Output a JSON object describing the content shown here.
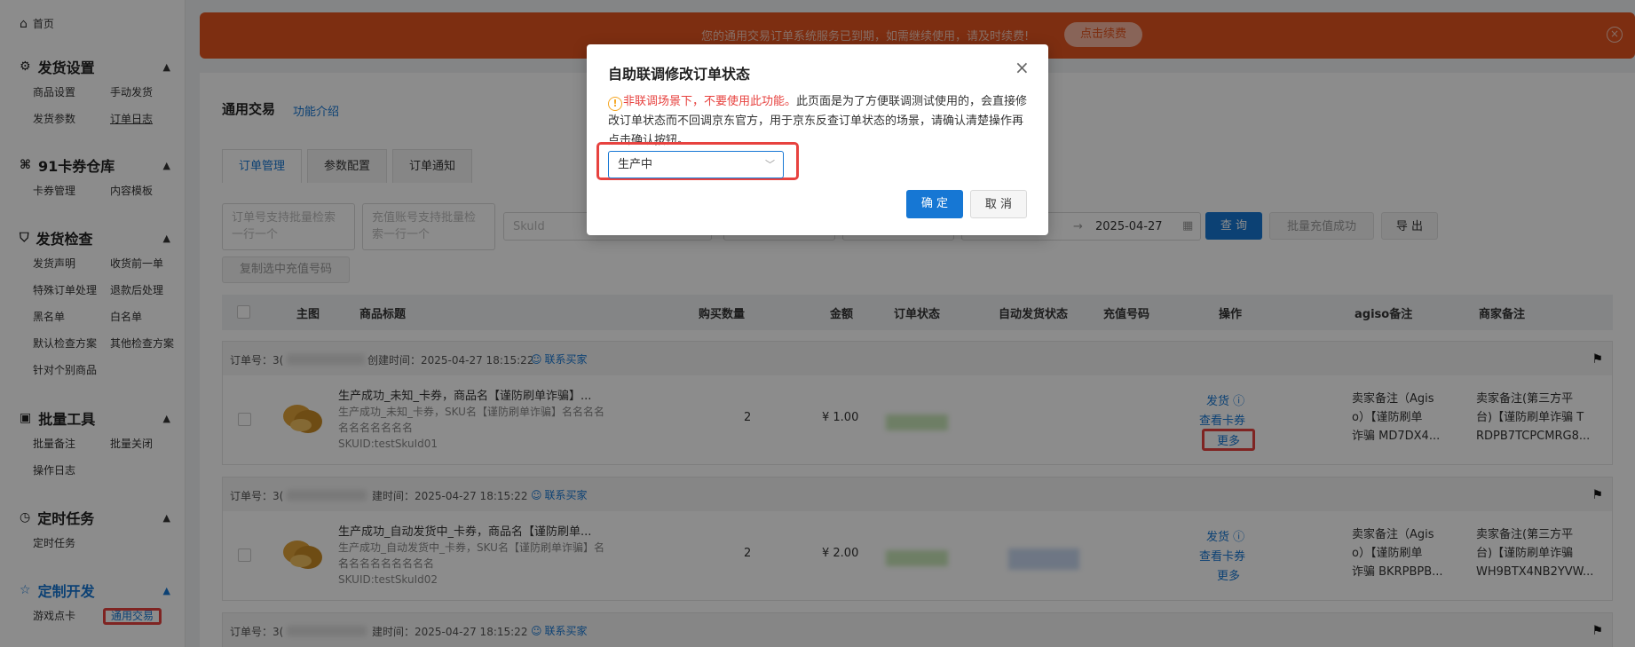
{
  "sidebar": {
    "home": "首页",
    "groups": [
      {
        "title": "发货设置",
        "items": [
          "商品设置",
          "手动发货",
          "发货参数",
          "订单日志"
        ]
      },
      {
        "title": "91卡券仓库",
        "items": [
          "卡券管理",
          "内容模板"
        ]
      },
      {
        "title": "发货检查",
        "items": [
          "发货声明",
          "收货前一单",
          "特殊订单处理",
          "退款后处理",
          "黑名单",
          "白名单",
          "默认检查方案",
          "其他检查方案",
          "针对个别商品"
        ]
      },
      {
        "title": "批量工具",
        "items": [
          "批量备注",
          "批量关闭",
          "操作日志"
        ]
      },
      {
        "title": "定时任务",
        "items": [
          "定时任务"
        ]
      },
      {
        "title": "定制开发",
        "items": [
          "游戏点卡",
          "通用交易"
        ]
      }
    ]
  },
  "banner": {
    "text": "您的通用交易订单系统服务已到期，如需继续使用，请及时续费!",
    "renew": "点击续费",
    "close": "×"
  },
  "main": {
    "title": "通用交易",
    "feature_link": "功能介绍",
    "tabs": [
      "订单管理",
      "参数配置",
      "订单通知"
    ],
    "filters": {
      "order_no": "订单号支持批量检索 一行一个",
      "recharge_no": "充值账号支持批量检 索一行一个",
      "skuid": "SkuId",
      "date_sep": "→",
      "date_end": "2025-04-27",
      "query": "查 询",
      "batch_success": "批量充值成功",
      "export": "导 出",
      "copy": "复制选中充值号码"
    },
    "columns": [
      "主图",
      "商品标题",
      "购买数量",
      "金额",
      "订单状态",
      "自动发货状态",
      "充值号码",
      "操作",
      "agiso备注",
      "商家备注"
    ],
    "orders": [
      {
        "order_label": "订单号：3(",
        "created": "创建时间：2025-04-27 18:15:22",
        "contact": "联系买家",
        "title": "生产成功_未知_卡券，商品名【谨防刷单诈骗】...",
        "sub1": "生产成功_未知_卡券，SKU名【谨防刷单诈骗】名名名名",
        "sub2": "名名名名名名名",
        "skuid": "SKUID:testSkuId01",
        "qty": "2",
        "amount": "¥ 1.00",
        "op_send": "发货",
        "op_view": "查看卡券",
        "op_more": "更多",
        "agiso": [
          "卖家备注（Agis",
          "o）【谨防刷单",
          "诈骗 MD7DX4..."
        ],
        "merchant": [
          "卖家备注(第三方平",
          "台)【谨防刷单诈骗 T",
          "RDPB7TCPCMRG8..."
        ]
      },
      {
        "order_label": "订单号：3(",
        "created": "建时间：2025-04-27 18:15:22",
        "contact": "联系买家",
        "title": "生产成功_自动发货中_卡券，商品名【谨防刷单...",
        "sub1": "生产成功_自动发货中_卡券，SKU名【谨防刷单诈骗】名名",
        "sub2": "名名名名名名名名名",
        "skuid": "SKUID:testSkuId02",
        "qty": "2",
        "amount": "¥ 2.00",
        "op_send": "发货",
        "op_view": "查看卡券",
        "op_more": "更多",
        "agiso": [
          "卖家备注（Agis",
          "o）【谨防刷单",
          "诈骗 BKRPBPB..."
        ],
        "merchant": [
          "卖家备注(第三方平",
          "台)【谨防刷单诈骗",
          "WH9BTX4NB2YVW..."
        ]
      },
      {
        "order_label": "订单号：3(",
        "created": "建时间：2025-04-27 18:15:22",
        "contact": "联系买家"
      }
    ]
  },
  "modal": {
    "title": "自助联调修改订单状态",
    "close": "×",
    "warn_icon": "!",
    "warn_red": "非联调场景下，不要使用此功能。",
    "warn_rest": "此页面是为了方便联调测试使用的，会直接修改订单状态而不回调京东官方，用于京东反查订单状态的场景，请确认清楚操作再点击确认按钮。",
    "select_value": "生产中",
    "ok": "确 定",
    "cancel": "取 消"
  },
  "colors": {
    "accent": "#1677d4",
    "banner": "#e3551f",
    "highlight": "#e7423f",
    "warning": "#f5a623"
  }
}
